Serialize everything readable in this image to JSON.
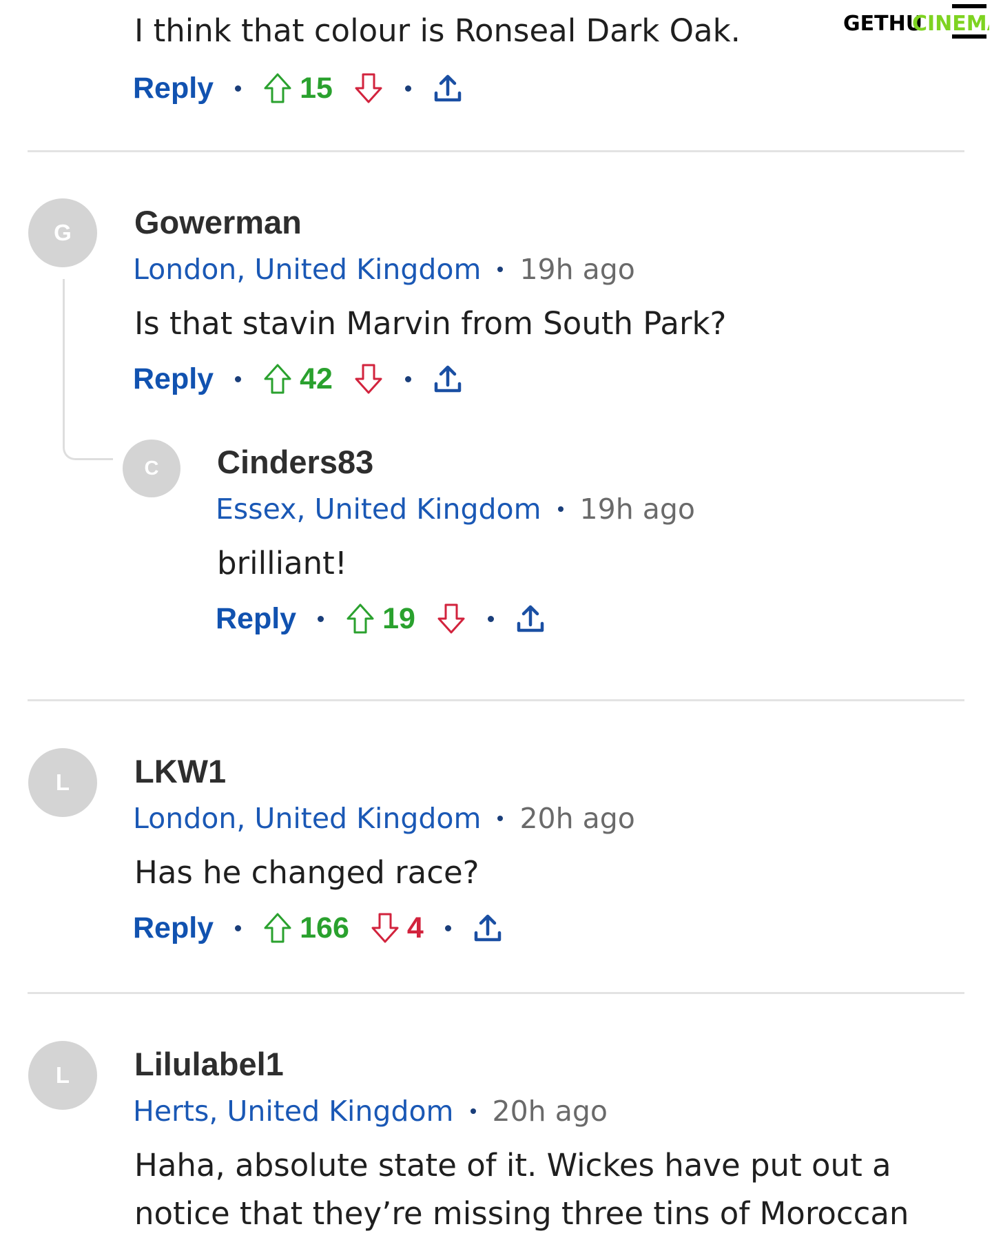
{
  "watermark": {
    "left": "GETHU",
    "right": "CINEMA",
    "left_color": "#000000",
    "right_color": "#7ed321"
  },
  "colors": {
    "reply": "#1152b0",
    "upvote": "#2aa12e",
    "downvote": "#d2233d",
    "location": "#1a58b5",
    "time": "#6a6a6a"
  },
  "top_comment": {
    "text": "I think that colour is Ronseal Dark Oak.",
    "reply_label": "Reply",
    "upvotes": "15"
  },
  "comments": [
    {
      "avatar": "G",
      "username": "Gowerman",
      "location": "London, United Kingdom",
      "time": "19h ago",
      "text": "Is that stavin Marvin from South Park?",
      "reply_label": "Reply",
      "upvotes": "42"
    },
    {
      "avatar": "C",
      "username": "Cinders83",
      "location": "Essex, United Kingdom",
      "time": "19h ago",
      "text": "brilliant!",
      "reply_label": "Reply",
      "upvotes": "19"
    },
    {
      "avatar": "L",
      "username": "LKW1",
      "location": "London, United Kingdom",
      "time": "20h ago",
      "text": "Has he changed race?",
      "reply_label": "Reply",
      "upvotes": "166",
      "downvotes": "4"
    },
    {
      "avatar": "L",
      "username": "Lilulabel1",
      "location": "Herts, United Kingdom",
      "time": "20h ago",
      "text_line1": "Haha, absolute state of it. Wickes have put out a",
      "text_line2": "notice that they’re missing three tins of Moroccan"
    }
  ],
  "icons": {
    "upvote": "arrow-up-outline-icon",
    "downvote": "arrow-down-outline-icon",
    "share": "share-upload-icon"
  }
}
